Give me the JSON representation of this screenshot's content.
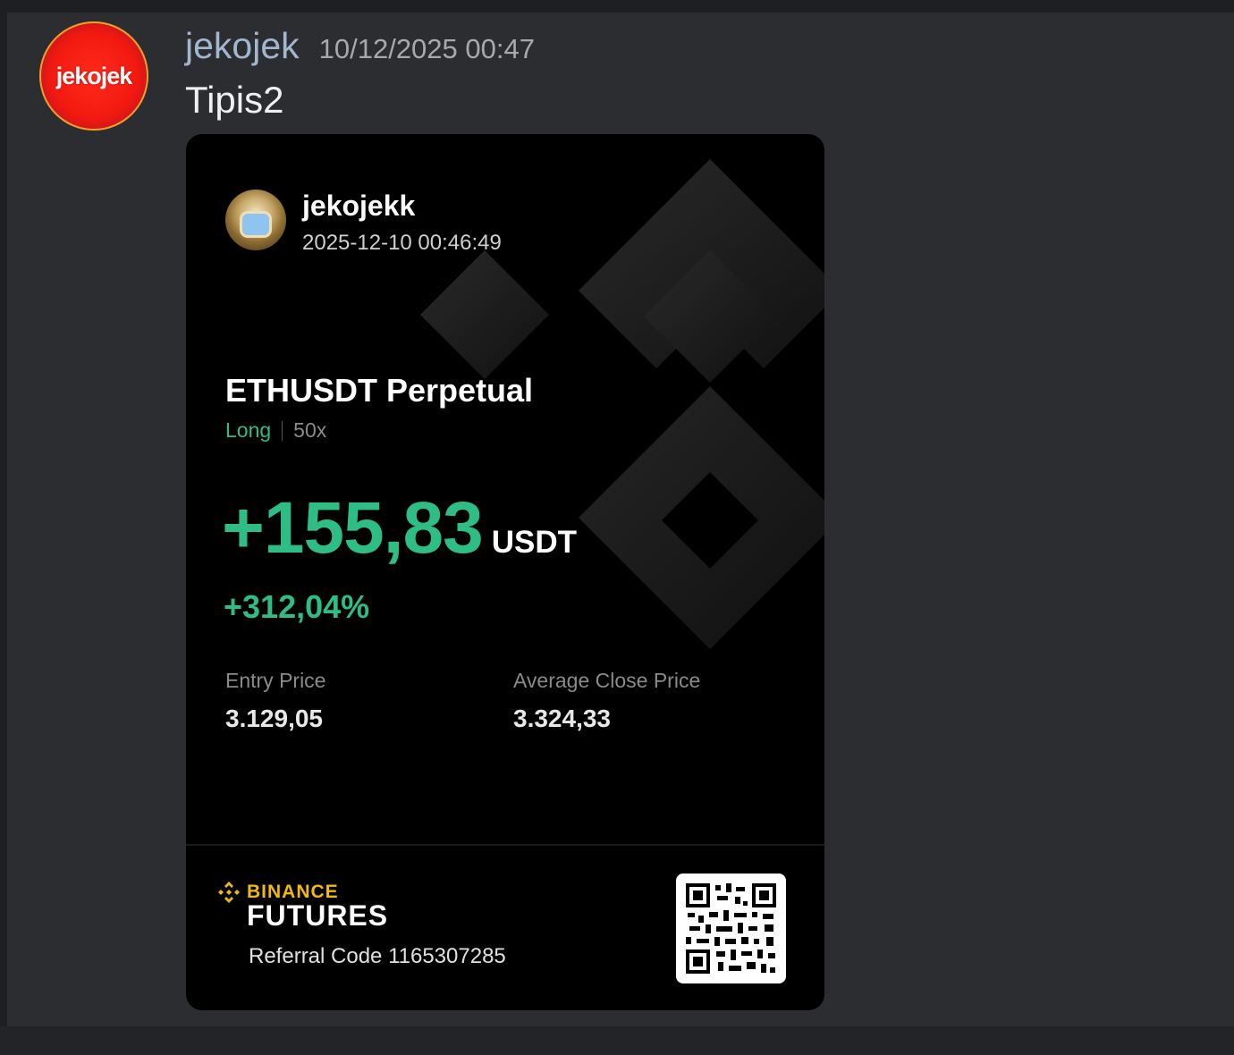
{
  "message": {
    "username": "jekojek",
    "timestamp": "10/12/2025 00:47",
    "text": "Tipis2",
    "avatar_text": "jekojek"
  },
  "card": {
    "username": "jekojekk",
    "datetime": "2025-12-10 00:46:49",
    "pair": "ETHUSDT Perpetual",
    "side": "Long",
    "leverage": "50x",
    "pnl": "+155,83",
    "pnl_unit": "USDT",
    "roi": "+312,04%",
    "entry_label": "Entry Price",
    "entry_value": "3.129,05",
    "close_label": "Average Close Price",
    "close_value": "3.324,33",
    "brand_top": "BINANCE",
    "brand_bottom": "FUTURES",
    "referral": "Referral Code 1165307285",
    "colors": {
      "profit": "#2ebd85",
      "brand": "#f0b90b"
    },
    "icons": [
      "binance-logo-icon",
      "qr-code-icon"
    ]
  }
}
